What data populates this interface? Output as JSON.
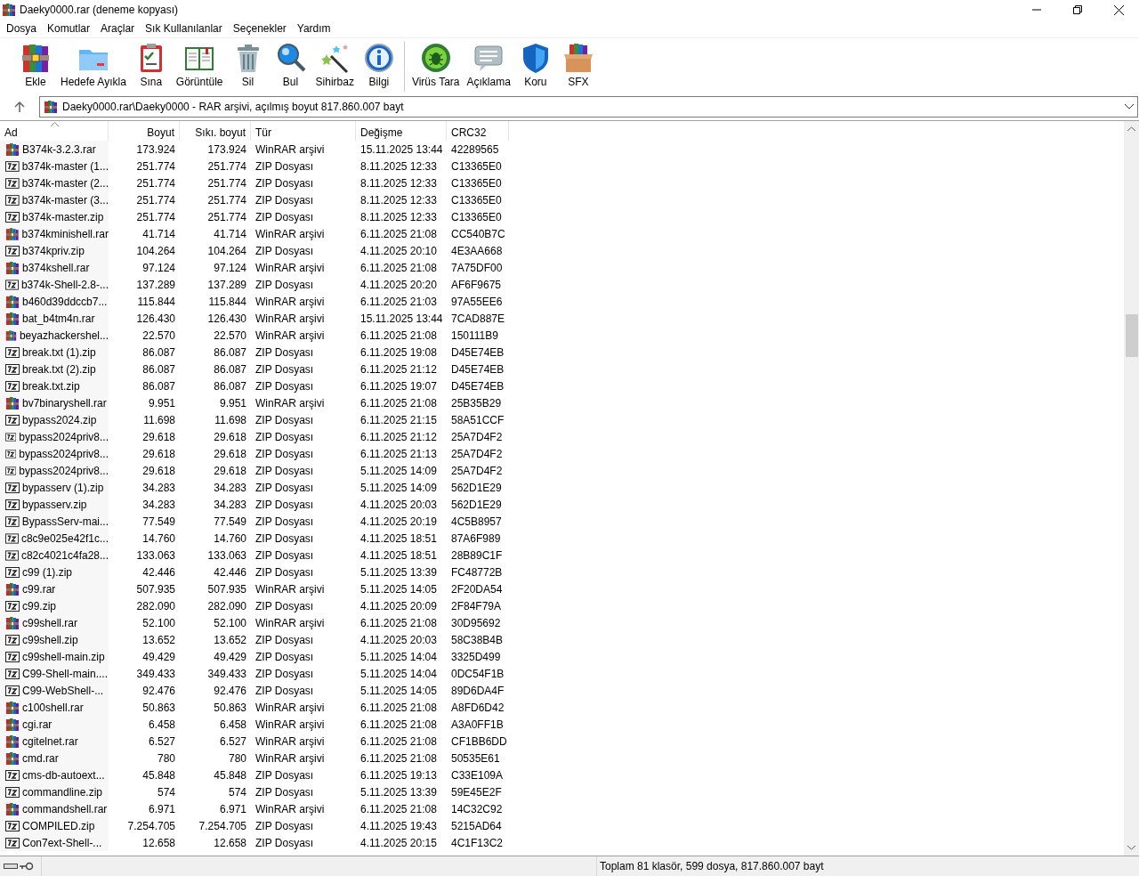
{
  "window": {
    "title": "Daeky0000.rar (deneme kopyası)"
  },
  "menu": [
    "Dosya",
    "Komutlar",
    "Araçlar",
    "Sık Kullanılanlar",
    "Seçenekler",
    "Yardım"
  ],
  "toolbar": {
    "groups": [
      [
        "Ekle",
        "Hedefe Ayıkla",
        "Sına",
        "Görüntüle",
        "Sil",
        "Bul",
        "Sihirbaz",
        "Bilgi"
      ],
      [
        "Virüs Tara",
        "Açıklama",
        "Koru",
        "SFX"
      ]
    ]
  },
  "address": {
    "value": "Daeky0000.rar\\Daeky0000 - RAR arşivi, açılmış boyut 817.860.007 bayt"
  },
  "table": {
    "columns": [
      {
        "label": "Ad",
        "sorted": true
      },
      {
        "label": "Boyut",
        "sorted": false
      },
      {
        "label": "Sıkı. boyut",
        "sorted": false
      },
      {
        "label": "Tür",
        "sorted": false
      },
      {
        "label": "Değişme",
        "sorted": false
      },
      {
        "label": "CRC32",
        "sorted": false
      }
    ],
    "rows": [
      {
        "kind": "rar",
        "cells": [
          "B374k-3.2.3.rar",
          "173.924",
          "173.924",
          "WinRAR arşivi",
          "15.11.2025 13:44",
          "42289565"
        ]
      },
      {
        "kind": "zip",
        "cells": [
          "b374k-master (1...",
          "251.774",
          "251.774",
          "ZIP Dosyası",
          "8.11.2025 12:33",
          "C13365E0"
        ]
      },
      {
        "kind": "zip",
        "cells": [
          "b374k-master (2...",
          "251.774",
          "251.774",
          "ZIP Dosyası",
          "8.11.2025 12:33",
          "C13365E0"
        ]
      },
      {
        "kind": "zip",
        "cells": [
          "b374k-master (3...",
          "251.774",
          "251.774",
          "ZIP Dosyası",
          "8.11.2025 12:33",
          "C13365E0"
        ]
      },
      {
        "kind": "zip",
        "cells": [
          "b374k-master.zip",
          "251.774",
          "251.774",
          "ZIP Dosyası",
          "8.11.2025 12:33",
          "C13365E0"
        ]
      },
      {
        "kind": "rar",
        "cells": [
          "b374kminishell.rar",
          "41.714",
          "41.714",
          "WinRAR arşivi",
          "6.11.2025 21:08",
          "CC540B7C"
        ]
      },
      {
        "kind": "zip",
        "cells": [
          "b374kpriv.zip",
          "104.264",
          "104.264",
          "ZIP Dosyası",
          "4.11.2025 20:10",
          "4E3AA668"
        ]
      },
      {
        "kind": "rar",
        "cells": [
          "b374kshell.rar",
          "97.124",
          "97.124",
          "WinRAR arşivi",
          "6.11.2025 21:08",
          "7A75DF00"
        ]
      },
      {
        "kind": "zip",
        "cells": [
          "b374k-Shell-2.8-...",
          "137.289",
          "137.289",
          "ZIP Dosyası",
          "4.11.2025 20:20",
          "AF6F9675"
        ]
      },
      {
        "kind": "rar",
        "cells": [
          "b460d39ddccb7...",
          "115.844",
          "115.844",
          "WinRAR arşivi",
          "6.11.2025 21:03",
          "97A55EE6"
        ]
      },
      {
        "kind": "rar",
        "cells": [
          "bat_b4tm4n.rar",
          "126.430",
          "126.430",
          "WinRAR arşivi",
          "15.11.2025 13:44",
          "7CAD887E"
        ]
      },
      {
        "kind": "rar",
        "cells": [
          "beyazhackershel...",
          "22.570",
          "22.570",
          "WinRAR arşivi",
          "6.11.2025 21:08",
          "150111B9"
        ]
      },
      {
        "kind": "zip",
        "cells": [
          "break.txt (1).zip",
          "86.087",
          "86.087",
          "ZIP Dosyası",
          "6.11.2025 19:08",
          "D45E74EB"
        ]
      },
      {
        "kind": "zip",
        "cells": [
          "break.txt (2).zip",
          "86.087",
          "86.087",
          "ZIP Dosyası",
          "6.11.2025 21:12",
          "D45E74EB"
        ]
      },
      {
        "kind": "zip",
        "cells": [
          "break.txt.zip",
          "86.087",
          "86.087",
          "ZIP Dosyası",
          "6.11.2025 19:07",
          "D45E74EB"
        ]
      },
      {
        "kind": "rar",
        "cells": [
          "bv7binaryshell.rar",
          "9.951",
          "9.951",
          "WinRAR arşivi",
          "6.11.2025 21:08",
          "25B35B29"
        ]
      },
      {
        "kind": "zip",
        "cells": [
          "bypass2024.zip",
          "11.698",
          "11.698",
          "ZIP Dosyası",
          "6.11.2025 21:15",
          "58A51CCF"
        ]
      },
      {
        "kind": "zip",
        "cells": [
          "bypass2024priv8...",
          "29.618",
          "29.618",
          "ZIP Dosyası",
          "6.11.2025 21:12",
          "25A7D4F2"
        ]
      },
      {
        "kind": "zip",
        "cells": [
          "bypass2024priv8...",
          "29.618",
          "29.618",
          "ZIP Dosyası",
          "6.11.2025 21:13",
          "25A7D4F2"
        ]
      },
      {
        "kind": "zip",
        "cells": [
          "bypass2024priv8...",
          "29.618",
          "29.618",
          "ZIP Dosyası",
          "5.11.2025 14:09",
          "25A7D4F2"
        ]
      },
      {
        "kind": "zip",
        "cells": [
          "bypasserv (1).zip",
          "34.283",
          "34.283",
          "ZIP Dosyası",
          "5.11.2025 14:09",
          "562D1E29"
        ]
      },
      {
        "kind": "zip",
        "cells": [
          "bypasserv.zip",
          "34.283",
          "34.283",
          "ZIP Dosyası",
          "4.11.2025 20:03",
          "562D1E29"
        ]
      },
      {
        "kind": "zip",
        "cells": [
          "BypassServ-mai...",
          "77.549",
          "77.549",
          "ZIP Dosyası",
          "4.11.2025 20:19",
          "4C5B8957"
        ]
      },
      {
        "kind": "zip",
        "cells": [
          "c8c9e025e42f1c...",
          "14.760",
          "14.760",
          "ZIP Dosyası",
          "4.11.2025 18:51",
          "87A6F989"
        ]
      },
      {
        "kind": "zip",
        "cells": [
          "c82c4021c4fa28...",
          "133.063",
          "133.063",
          "ZIP Dosyası",
          "4.11.2025 18:51",
          "28B89C1F"
        ]
      },
      {
        "kind": "zip",
        "cells": [
          "c99 (1).zip",
          "42.446",
          "42.446",
          "ZIP Dosyası",
          "5.11.2025 13:39",
          "FC48772B"
        ]
      },
      {
        "kind": "rar",
        "cells": [
          "c99.rar",
          "507.935",
          "507.935",
          "WinRAR arşivi",
          "5.11.2025 14:05",
          "2F20DA54"
        ]
      },
      {
        "kind": "zip",
        "cells": [
          "c99.zip",
          "282.090",
          "282.090",
          "ZIP Dosyası",
          "4.11.2025 20:09",
          "2F84F79A"
        ]
      },
      {
        "kind": "rar",
        "cells": [
          "c99shell.rar",
          "52.100",
          "52.100",
          "WinRAR arşivi",
          "6.11.2025 21:08",
          "30D95692"
        ]
      },
      {
        "kind": "zip",
        "cells": [
          "c99shell.zip",
          "13.652",
          "13.652",
          "ZIP Dosyası",
          "4.11.2025 20:03",
          "58C38B4B"
        ]
      },
      {
        "kind": "zip",
        "cells": [
          "c99shell-main.zip",
          "49.429",
          "49.429",
          "ZIP Dosyası",
          "5.11.2025 14:04",
          "3325D499"
        ]
      },
      {
        "kind": "zip",
        "cells": [
          "C99-Shell-main....",
          "349.433",
          "349.433",
          "ZIP Dosyası",
          "5.11.2025 14:04",
          "0DC54F1B"
        ]
      },
      {
        "kind": "zip",
        "cells": [
          "C99-WebShell-...",
          "92.476",
          "92.476",
          "ZIP Dosyası",
          "5.11.2025 14:05",
          "89D6DA4F"
        ]
      },
      {
        "kind": "rar",
        "cells": [
          "c100shell.rar",
          "50.863",
          "50.863",
          "WinRAR arşivi",
          "6.11.2025 21:08",
          "A8FD6D42"
        ]
      },
      {
        "kind": "rar",
        "cells": [
          "cgi.rar",
          "6.458",
          "6.458",
          "WinRAR arşivi",
          "6.11.2025 21:08",
          "A3A0FF1B"
        ]
      },
      {
        "kind": "rar",
        "cells": [
          "cgitelnet.rar",
          "6.527",
          "6.527",
          "WinRAR arşivi",
          "6.11.2025 21:08",
          "CF1BB6DD"
        ]
      },
      {
        "kind": "rar",
        "cells": [
          "cmd.rar",
          "780",
          "780",
          "WinRAR arşivi",
          "6.11.2025 21:08",
          "50535E61"
        ]
      },
      {
        "kind": "zip",
        "cells": [
          "cms-db-autoext...",
          "45.848",
          "45.848",
          "ZIP Dosyası",
          "6.11.2025 19:13",
          "C33E109A"
        ]
      },
      {
        "kind": "zip",
        "cells": [
          "commandline.zip",
          "574",
          "574",
          "ZIP Dosyası",
          "5.11.2025 13:39",
          "59E45E2F"
        ]
      },
      {
        "kind": "rar",
        "cells": [
          "commandshell.rar",
          "6.971",
          "6.971",
          "WinRAR arşivi",
          "6.11.2025 21:08",
          "14C32C92"
        ]
      },
      {
        "kind": "zip",
        "cells": [
          "COMPILED.zip",
          "7.254.705",
          "7.254.705",
          "ZIP Dosyası",
          "4.11.2025 19:43",
          "5215AD64"
        ]
      },
      {
        "kind": "zip",
        "cells": [
          "Con7ext-Shell-...",
          "12.658",
          "12.658",
          "ZIP Dosyası",
          "4.11.2025 20:15",
          "4C1F13C2"
        ]
      }
    ]
  },
  "status_bar": {
    "text": "Toplam 81 klasör, 599 dosya, 817.860.007 bayt"
  }
}
